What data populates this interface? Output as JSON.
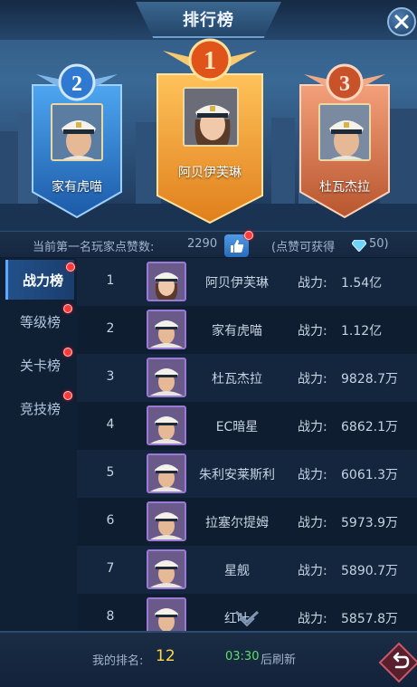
{
  "header": {
    "title": "排行榜"
  },
  "podium": [
    {
      "rank": "2",
      "name": "家有虎喵"
    },
    {
      "rank": "1",
      "name": "阿贝伊芙琳"
    },
    {
      "rank": "3",
      "name": "杜瓦杰拉"
    }
  ],
  "likes": {
    "label": "当前第一名玩家点赞数:",
    "count": "2290",
    "reward_label": "(点赞可获得",
    "reward_value": "50)"
  },
  "tabs": [
    "战力榜",
    "等级榜",
    "关卡榜",
    "竞技榜"
  ],
  "ranking": [
    {
      "rank": "1",
      "name": "阿贝伊芙琳",
      "label": "战力:",
      "value": "1.54亿"
    },
    {
      "rank": "2",
      "name": "家有虎喵",
      "label": "战力:",
      "value": "1.12亿"
    },
    {
      "rank": "3",
      "name": "杜瓦杰拉",
      "label": "战力:",
      "value": "9828.7万"
    },
    {
      "rank": "4",
      "name": "EC暗星",
      "label": "战力:",
      "value": "6862.1万"
    },
    {
      "rank": "5",
      "name": "朱利安莱斯利",
      "label": "战力:",
      "value": "6061.3万"
    },
    {
      "rank": "6",
      "name": "拉塞尔提姆",
      "label": "战力:",
      "value": "5973.9万"
    },
    {
      "rank": "7",
      "name": "星舰",
      "label": "战力:",
      "value": "5890.7万"
    },
    {
      "rank": "8",
      "name": "红叶",
      "label": "战力:",
      "value": "5857.8万"
    }
  ],
  "footer": {
    "my_rank_label": "我的排名:",
    "my_rank": "12",
    "refresh_time": "03:30",
    "refresh_label": "后刷新"
  },
  "colors": {
    "accent": "#2a6bbc",
    "gold": "#f2a33a",
    "silver_blue": "#3b7fd0",
    "bronze": "#d8784a",
    "rank_highlight": "#ffd94a",
    "timer": "#5fdf6a"
  }
}
